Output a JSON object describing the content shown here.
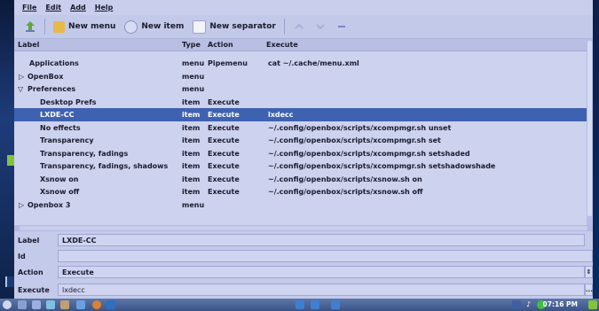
{
  "menubar": {
    "file": "File",
    "edit": "Edit",
    "add": "Add",
    "help": "Help"
  },
  "toolbar": {
    "new_menu": "New menu",
    "new_item": "New item",
    "new_separator": "New separator"
  },
  "columns": {
    "label": "Label",
    "type": "Type",
    "action": "Action",
    "execute": "Execute"
  },
  "rows": [
    {
      "label": "Applications",
      "type": "menu",
      "action": "Pipemenu",
      "execute": "cat ~/.cache/menu.xml"
    },
    {
      "label": "OpenBox",
      "type": "menu",
      "action": "",
      "execute": ""
    },
    {
      "label": "Preferences",
      "type": "menu",
      "action": "",
      "execute": ""
    },
    {
      "label": "Desktop Prefs",
      "type": "item",
      "action": "Execute",
      "execute": ""
    },
    {
      "label": "LXDE-CC",
      "type": "item",
      "action": "Execute",
      "execute": "lxdecc"
    },
    {
      "label": "No effects",
      "type": "item",
      "action": "Execute",
      "execute": "~/.config/openbox/scripts/xcompmgr.sh unset"
    },
    {
      "label": "Transparency",
      "type": "item",
      "action": "Execute",
      "execute": "~/.config/openbox/scripts/xcompmgr.sh set"
    },
    {
      "label": "Transparency, fadings",
      "type": "item",
      "action": "Execute",
      "execute": "~/.config/openbox/scripts/xcompmgr.sh setshaded"
    },
    {
      "label": "Transparency, fadings, shadows",
      "type": "item",
      "action": "Execute",
      "execute": "~/.config/openbox/scripts/xcompmgr.sh setshadowshade"
    },
    {
      "label": "Xsnow on",
      "type": "item",
      "action": "Execute",
      "execute": "~/.config/openbox/scripts/xsnow.sh on"
    },
    {
      "label": "Xsnow off",
      "type": "item",
      "action": "Execute",
      "execute": "~/.config/openbox/scripts/xsnow.sh off"
    },
    {
      "label": "Openbox 3",
      "type": "menu",
      "action": "",
      "execute": ""
    }
  ],
  "form": {
    "label_caption": "Label",
    "label_value": "LXDE-CC",
    "id_caption": "Id",
    "id_value": "",
    "action_caption": "Action",
    "action_value": "Execute",
    "execute_caption": "Execute",
    "execute_value": "lxdecc"
  },
  "taskbar": {
    "clock": "07:16 PM"
  },
  "colors": {
    "selection": "#3f62b0",
    "window_bg": "#c5cbea"
  }
}
